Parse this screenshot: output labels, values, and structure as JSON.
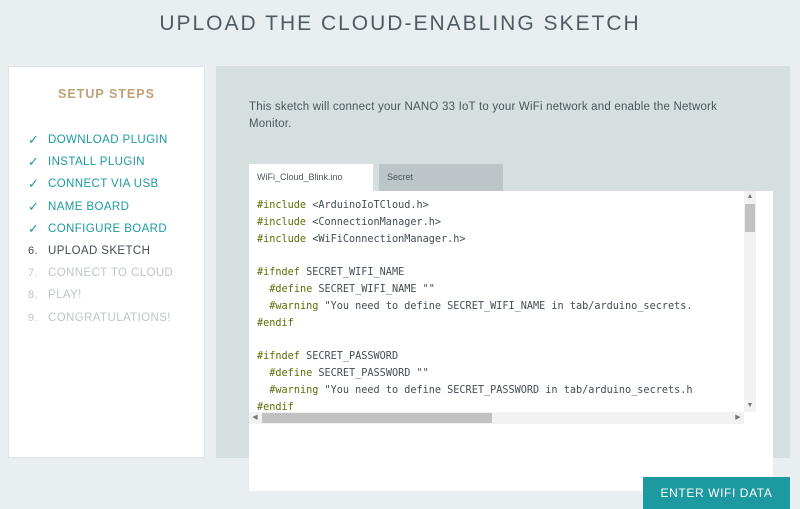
{
  "page_title": "UPLOAD THE CLOUD-ENABLING SKETCH",
  "sidebar": {
    "title": "SETUP STEPS",
    "steps": [
      {
        "marker": "✓",
        "label": "DOWNLOAD PLUGIN",
        "status": "done"
      },
      {
        "marker": "✓",
        "label": "INSTALL PLUGIN",
        "status": "done"
      },
      {
        "marker": "✓",
        "label": "CONNECT VIA USB",
        "status": "done"
      },
      {
        "marker": "✓",
        "label": "NAME BOARD",
        "status": "done"
      },
      {
        "marker": "✓",
        "label": "CONFIGURE BOARD",
        "status": "done"
      },
      {
        "marker": "6.",
        "label": "UPLOAD SKETCH",
        "status": "current"
      },
      {
        "marker": "7.",
        "label": "CONNECT TO CLOUD",
        "status": "todo"
      },
      {
        "marker": "8.",
        "label": "PLAY!",
        "status": "todo"
      },
      {
        "marker": "9.",
        "label": "CONGRATULATIONS!",
        "status": "todo"
      }
    ]
  },
  "main": {
    "intro": "This sketch will connect your NANO 33 IoT to your WiFi network and enable the Network Monitor.",
    "tabs": [
      {
        "label": "WiFi_Cloud_Blink.ino",
        "active": true
      },
      {
        "label": "Secret",
        "active": false
      }
    ],
    "code_lines": [
      {
        "kw": "#include",
        "rest": " <ArduinoIoTCloud.h>",
        "indent": ""
      },
      {
        "kw": "#include",
        "rest": " <ConnectionManager.h>",
        "indent": ""
      },
      {
        "kw": "#include",
        "rest": " <WiFiConnectionManager.h>",
        "indent": ""
      },
      {
        "kw": "",
        "rest": "",
        "indent": ""
      },
      {
        "kw": "#ifndef",
        "rest": " SECRET_WIFI_NAME",
        "indent": ""
      },
      {
        "kw": "#define",
        "rest": " SECRET_WIFI_NAME \"\"",
        "indent": "  "
      },
      {
        "kw": "#warning",
        "rest": " \"You need to define SECRET_WIFI_NAME in tab/arduino_secrets.",
        "indent": "  "
      },
      {
        "kw": "#endif",
        "rest": "",
        "indent": ""
      },
      {
        "kw": "",
        "rest": "",
        "indent": ""
      },
      {
        "kw": "#ifndef",
        "rest": " SECRET_PASSWORD",
        "indent": ""
      },
      {
        "kw": "#define",
        "rest": " SECRET_PASSWORD \"\"",
        "indent": "  "
      },
      {
        "kw": "#warning",
        "rest": " \"You need to define SECRET_PASSWORD in tab/arduino_secrets.h",
        "indent": "  "
      },
      {
        "kw": "#endif",
        "rest": "",
        "indent": ""
      }
    ]
  },
  "footer": {
    "primary_button": "ENTER WIFI DATA"
  },
  "colors": {
    "accent": "#1d9aa0",
    "sidebar_title": "#c0a076",
    "keyword": "#5e6d03"
  }
}
